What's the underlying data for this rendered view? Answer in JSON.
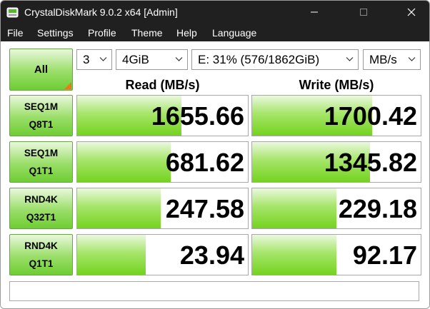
{
  "window": {
    "title": "CrystalDiskMark 9.0.2 x64 [Admin]",
    "controls": {
      "minimize": "minimize-icon",
      "maximize": "maximize-icon",
      "close": "close-icon"
    }
  },
  "menu": [
    "File",
    "Settings",
    "Profile",
    "Theme",
    "Help",
    "Language"
  ],
  "toolbar": {
    "all_label": "All",
    "count": "3",
    "size": "4GiB",
    "drive": "E: 31% (576/1862GiB)",
    "unit": "MB/s"
  },
  "headers": {
    "read": "Read (MB/s)",
    "write": "Write (MB/s)"
  },
  "tests": [
    {
      "line1": "SEQ1M",
      "line2": "Q8T1",
      "read": "1655.66",
      "write": "1700.42",
      "read_fill": 0.61,
      "write_fill": 0.71
    },
    {
      "line1": "SEQ1M",
      "line2": "Q1T1",
      "read": "681.62",
      "write": "1345.82",
      "read_fill": 0.55,
      "write_fill": 0.7
    },
    {
      "line1": "RND4K",
      "line2": "Q32T1",
      "read": "247.58",
      "write": "229.18",
      "read_fill": 0.49,
      "write_fill": 0.5
    },
    {
      "line1": "RND4K",
      "line2": "Q1T1",
      "read": "23.94",
      "write": "92.17",
      "read_fill": 0.4,
      "write_fill": 0.5
    }
  ],
  "status_text": "",
  "colors": {
    "titlebar": "#202020",
    "bar_green": "#74d31e",
    "button_green": "#99de68",
    "accent_orange": "#e87a1d"
  }
}
